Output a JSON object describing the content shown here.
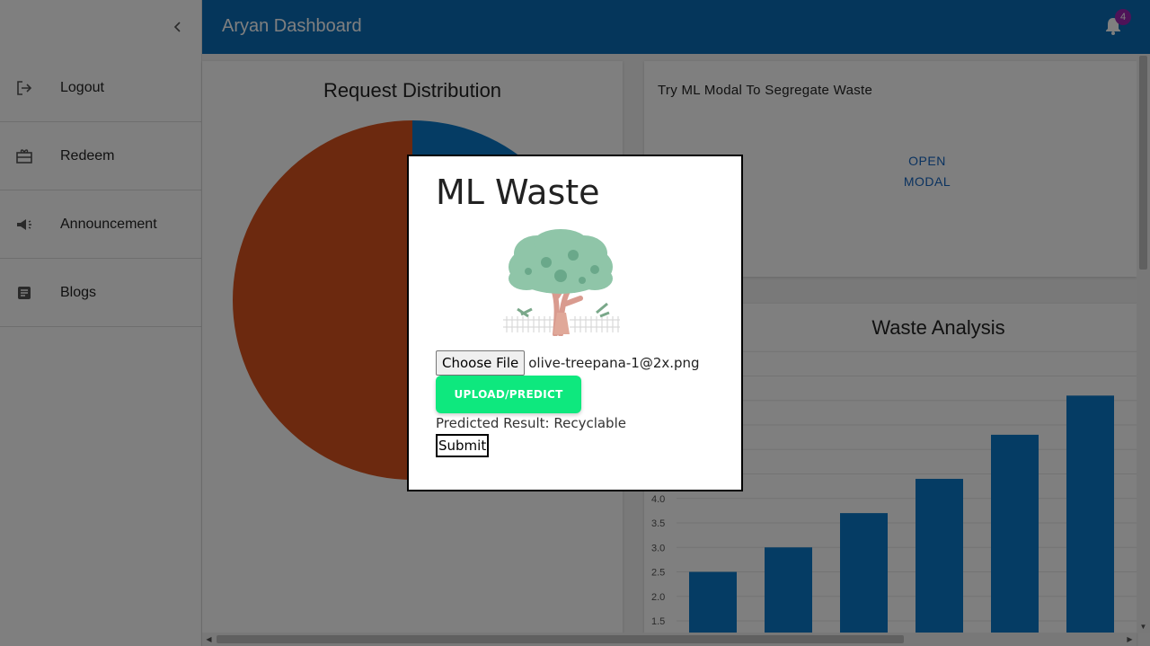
{
  "app": {
    "title": "Aryan Dashboard",
    "notification_count": "4"
  },
  "sidebar": {
    "items": [
      {
        "label": "Logout",
        "icon": "logout-icon"
      },
      {
        "label": "Redeem",
        "icon": "redeem-icon"
      },
      {
        "label": "Announcement",
        "icon": "announcement-icon"
      },
      {
        "label": "Blogs",
        "icon": "blogs-icon"
      }
    ]
  },
  "cards": {
    "request_distribution": {
      "title": "Request Distribution"
    },
    "ml_waste": {
      "title": "Try ML Modal To Segregate Waste",
      "open_line1": "OPEN",
      "open_line2": "MODAL"
    },
    "waste_analysis": {
      "title": "Waste Analysis"
    }
  },
  "modal": {
    "title": "ML Waste",
    "choose_file_label": "Choose File",
    "file_name": "olive-treepana-1@2x.png",
    "upload_label": "UPLOAD/PREDICT",
    "predicted_result": "Predicted Result: Recyclable",
    "submit_label": "Submit"
  },
  "colors": {
    "brand": "#0b6cb6",
    "pie_slice_orange": "#d9531e",
    "pie_slice_blue": "#0b79c9",
    "bar": "#0b79c9",
    "upload_button": "#0ee87e",
    "badge": "#9c27b0"
  },
  "chart_data": [
    {
      "type": "pie",
      "title": "Request Distribution",
      "values": [
        75,
        25
      ],
      "colors": [
        "#d9531e",
        "#0b79c9"
      ]
    },
    {
      "type": "bar",
      "title": "Waste Analysis",
      "values": [
        2.5,
        3.0,
        3.7,
        4.4,
        5.3,
        6.1
      ],
      "y_ticks": [
        "1.5",
        "2.0",
        "2.5",
        "3.0",
        "3.5",
        "4.0"
      ],
      "grid": true
    }
  ]
}
